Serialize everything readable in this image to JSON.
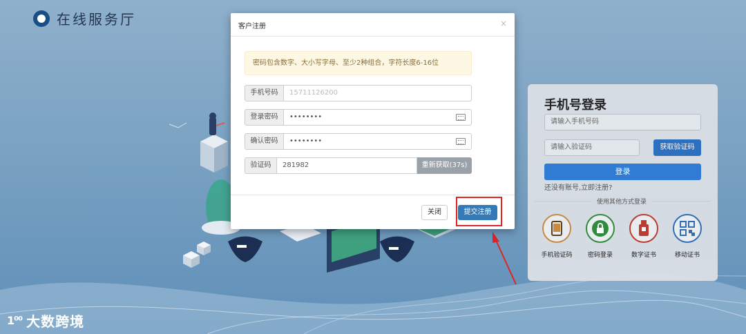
{
  "brand": {
    "name": "在线服务厅"
  },
  "watermark": {
    "icon": "1⁰⁰",
    "text": "大数跨境"
  },
  "modal": {
    "title": "客户注册",
    "close": "×",
    "notice": "密码包含数字、大小写字母、至少2种组合，字符长度6-16位",
    "fields": {
      "phone": {
        "label": "手机号码",
        "value": "15711126200"
      },
      "password": {
        "label": "登录密码",
        "value": "••••••••"
      },
      "confirm": {
        "label": "确认密码",
        "value": "••••••••"
      },
      "code": {
        "label": "验证码",
        "value": "281982",
        "button": "重新获取(37s)"
      }
    },
    "buttons": {
      "close": "关闭",
      "submit": "提交注册"
    }
  },
  "login": {
    "title": "手机号登录",
    "phone_placeholder": "请输入手机号码",
    "code_placeholder": "请输入验证码",
    "get_code": "获取验证码",
    "login_button": "登录",
    "register_link": "还没有账号,立即注册?",
    "other_methods": "使用其他方式登录",
    "methods": [
      {
        "label": "手机验证码",
        "icon": "phone-icon",
        "color": "#c98a3e"
      },
      {
        "label": "密码登录",
        "icon": "lock-icon",
        "color": "#2e8b3a"
      },
      {
        "label": "数字证书",
        "icon": "usb-key-icon",
        "color": "#c0392b"
      },
      {
        "label": "移动证书",
        "icon": "qr-code-icon",
        "color": "#2f6db5"
      }
    ]
  },
  "colors": {
    "primary": "#337ab7",
    "highlight": "#e02424",
    "warning_bg": "#fcf8e3"
  }
}
